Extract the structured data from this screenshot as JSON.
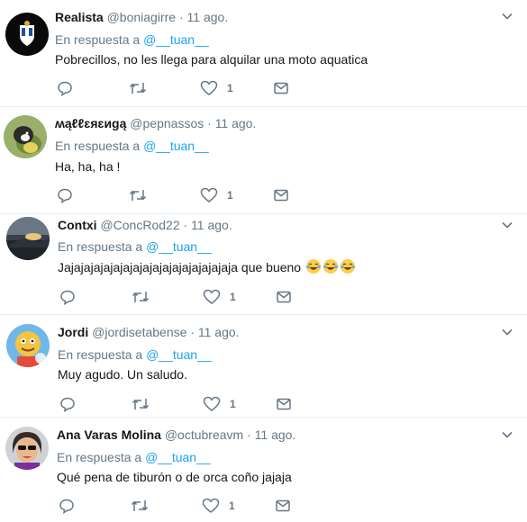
{
  "colors": {
    "link": "#1da1f2",
    "secondary": "#657786",
    "text": "#14171a",
    "divider": "#e6ecf0"
  },
  "icons": {
    "reply": "reply-icon",
    "retweet": "retweet-icon",
    "like": "heart-icon",
    "dm": "envelope-icon",
    "menu": "chevron-down-icon"
  },
  "tweets": [
    {
      "name": "Realista",
      "handle": "@boniagirre",
      "dot": "·",
      "time": "11 ago.",
      "reply_prefix": "En respuesta a",
      "reply_to": "@__tuan__",
      "text": "Pobrecillos, no les llega para alquilar una moto aquatica",
      "emoji": [],
      "likes": "1"
    },
    {
      "name": "ʍąℓℓɛяɛиgą",
      "handle": "@pepnassos",
      "dot": "·",
      "time": "11 ago.",
      "reply_prefix": "En respuesta a",
      "reply_to": "@__tuan__",
      "text": "Ha, ha, ha !",
      "emoji": [],
      "likes": "1"
    },
    {
      "name": "Contxi",
      "handle": "@ConcRod22",
      "dot": "·",
      "time": "11 ago.",
      "reply_prefix": "En respuesta a",
      "reply_to": "@__tuan__",
      "text": "Jajajajajajajajajajajajajajajajajaja que bueno",
      "emoji": [
        "face-with-tears-of-joy",
        "face-with-tears-of-joy",
        "face-with-tears-of-joy"
      ],
      "likes": "1"
    },
    {
      "name": "Jordi",
      "handle": "@jordisetabense",
      "dot": "·",
      "time": "11 ago.",
      "reply_prefix": "En respuesta a",
      "reply_to": "@__tuan__",
      "text": "Muy agudo. Un saludo.",
      "emoji": [],
      "likes": "1"
    },
    {
      "name": "Ana Varas Molina",
      "handle": "@octubreavm",
      "dot": "·",
      "time": "11 ago.",
      "reply_prefix": "En respuesta a",
      "reply_to": "@__tuan__",
      "text": "Qué pena de tiburón o de orca coño jajaja",
      "emoji": [],
      "likes": "1"
    }
  ]
}
